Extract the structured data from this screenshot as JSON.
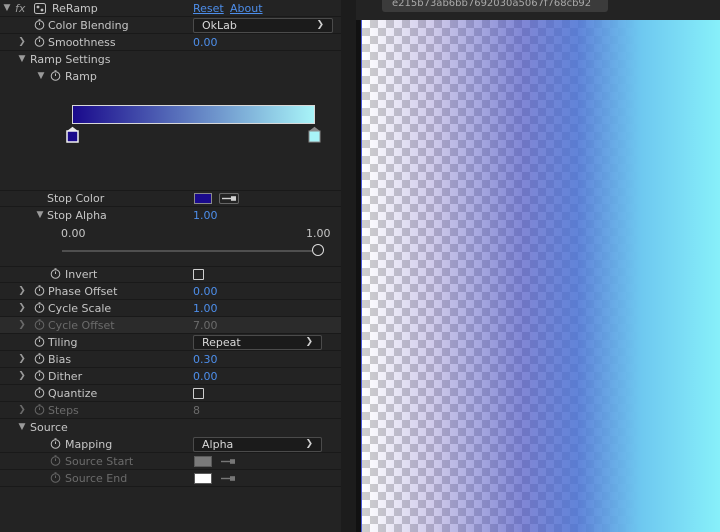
{
  "effect": {
    "name": "ReRamp",
    "fx_icon": "fx",
    "reset_label": "Reset",
    "about_label": "About"
  },
  "color_blending": {
    "label": "Color Blending",
    "value": "OkLab"
  },
  "smoothness": {
    "label": "Smoothness",
    "value": "0.00"
  },
  "ramp_settings": {
    "label": "Ramp Settings"
  },
  "ramp": {
    "label": "Ramp",
    "gradient_start": "#1a0a8c",
    "gradient_end": "#a8f4f8",
    "stop_left_color": "#1a0a8c",
    "stop_right_color": "#a8f4f8"
  },
  "stop_color": {
    "label": "Stop Color",
    "swatch": "#1a0a8c"
  },
  "stop_alpha": {
    "label": "Stop Alpha",
    "value": "1.00",
    "slider_min": "0.00",
    "slider_max": "1.00",
    "slider_level": 1.0
  },
  "invert": {
    "label": "Invert",
    "checked": false
  },
  "phase_offset": {
    "label": "Phase Offset",
    "value": "0.00"
  },
  "cycle_scale": {
    "label": "Cycle Scale",
    "value": "1.00"
  },
  "cycle_offset": {
    "label": "Cycle Offset",
    "value": "7.00"
  },
  "tiling": {
    "label": "Tiling",
    "value": "Repeat"
  },
  "bias": {
    "label": "Bias",
    "value": "0.30"
  },
  "dither": {
    "label": "Dither",
    "value": "0.00"
  },
  "quantize": {
    "label": "Quantize",
    "checked": false
  },
  "steps": {
    "label": "Steps",
    "value": "8"
  },
  "source": {
    "label": "Source"
  },
  "mapping": {
    "label": "Mapping",
    "value": "Alpha"
  },
  "source_start": {
    "label": "Source Start",
    "swatch": "#7a7a7a"
  },
  "source_end": {
    "label": "Source End",
    "swatch": "#ffffff"
  },
  "viewer": {
    "tab_label": "e215b73ab6bb7692030a5067f768cb92"
  },
  "colors": {
    "accent_blue": "#4d8eea",
    "panel_bg": "#232323"
  }
}
